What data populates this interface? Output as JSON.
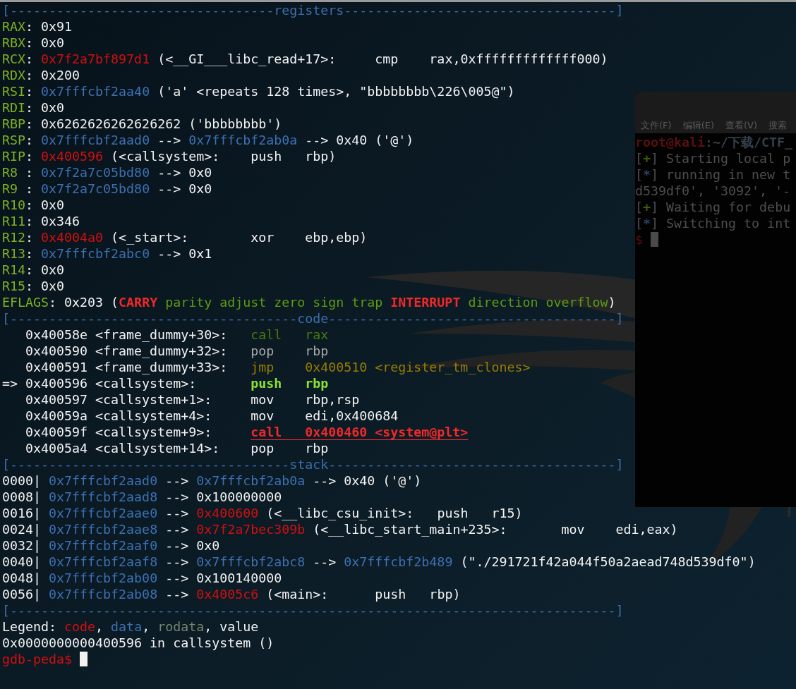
{
  "terminal": {
    "lines": [
      {
        "segments": [
          {
            "text": "[----------------------------------",
            "kind": "header"
          },
          {
            "text": "registers",
            "kind": "header"
          },
          {
            "text": "-----------------------------------]",
            "kind": "header"
          }
        ]
      },
      {
        "segments": [
          {
            "text": "RAX",
            "kind": "reg"
          },
          {
            "text": ": 0x91",
            "kind": "plain"
          }
        ]
      },
      {
        "segments": [
          {
            "text": "RBX",
            "kind": "reg"
          },
          {
            "text": ": 0x0",
            "kind": "plain"
          }
        ]
      },
      {
        "segments": [
          {
            "text": "RCX",
            "kind": "reg"
          },
          {
            "text": ": ",
            "kind": "plain"
          },
          {
            "text": "0x7f2a7bf897d1",
            "kind": "code"
          },
          {
            "text": " (<__GI___libc_read+17>:     cmp    rax,0xfffffffffffff000)",
            "kind": "plain"
          }
        ]
      },
      {
        "segments": [
          {
            "text": "RDX",
            "kind": "reg"
          },
          {
            "text": ": 0x200",
            "kind": "plain"
          }
        ]
      },
      {
        "segments": [
          {
            "text": "RSI",
            "kind": "reg"
          },
          {
            "text": ": ",
            "kind": "plain"
          },
          {
            "text": "0x7fffcbf2aa40",
            "kind": "data"
          },
          {
            "text": " ('a' <repeats 128 times>, \"bbbbbbbb\\226\\005@\")",
            "kind": "plain"
          }
        ]
      },
      {
        "segments": [
          {
            "text": "RDI",
            "kind": "reg"
          },
          {
            "text": ": 0x0",
            "kind": "plain"
          }
        ]
      },
      {
        "segments": [
          {
            "text": "RBP",
            "kind": "reg"
          },
          {
            "text": ": 0x6262626262626262 ('bbbbbbbb')",
            "kind": "plain"
          }
        ]
      },
      {
        "segments": [
          {
            "text": "RSP",
            "kind": "reg"
          },
          {
            "text": ": ",
            "kind": "plain"
          },
          {
            "text": "0x7fffcbf2aad0",
            "kind": "data"
          },
          {
            "text": " --> ",
            "kind": "plain"
          },
          {
            "text": "0x7fffcbf2ab0a",
            "kind": "data"
          },
          {
            "text": " --> 0x40 ('@')",
            "kind": "plain"
          }
        ]
      },
      {
        "segments": [
          {
            "text": "RIP",
            "kind": "reg"
          },
          {
            "text": ": ",
            "kind": "plain"
          },
          {
            "text": "0x400596",
            "kind": "code"
          },
          {
            "text": " (<callsystem>:    push   rbp)",
            "kind": "plain"
          }
        ]
      },
      {
        "segments": [
          {
            "text": "R8 ",
            "kind": "reg"
          },
          {
            "text": ": ",
            "kind": "plain"
          },
          {
            "text": "0x7f2a7c05bd80",
            "kind": "data"
          },
          {
            "text": " --> 0x0",
            "kind": "plain"
          }
        ]
      },
      {
        "segments": [
          {
            "text": "R9 ",
            "kind": "reg"
          },
          {
            "text": ": ",
            "kind": "plain"
          },
          {
            "text": "0x7f2a7c05bd80",
            "kind": "data"
          },
          {
            "text": " --> 0x0",
            "kind": "plain"
          }
        ]
      },
      {
        "segments": [
          {
            "text": "R10",
            "kind": "reg"
          },
          {
            "text": ": 0x0",
            "kind": "plain"
          }
        ]
      },
      {
        "segments": [
          {
            "text": "R11",
            "kind": "reg"
          },
          {
            "text": ": 0x346",
            "kind": "plain"
          }
        ]
      },
      {
        "segments": [
          {
            "text": "R12",
            "kind": "reg"
          },
          {
            "text": ": ",
            "kind": "plain"
          },
          {
            "text": "0x4004a0",
            "kind": "code"
          },
          {
            "text": " (<_start>:        xor    ebp,ebp)",
            "kind": "plain"
          }
        ]
      },
      {
        "segments": [
          {
            "text": "R13",
            "kind": "reg"
          },
          {
            "text": ": ",
            "kind": "plain"
          },
          {
            "text": "0x7fffcbf2abc0",
            "kind": "data"
          },
          {
            "text": " --> 0x1",
            "kind": "plain"
          }
        ]
      },
      {
        "segments": [
          {
            "text": "R14",
            "kind": "reg"
          },
          {
            "text": ": 0x0",
            "kind": "plain"
          }
        ]
      },
      {
        "segments": [
          {
            "text": "R15",
            "kind": "reg"
          },
          {
            "text": ": 0x0",
            "kind": "plain"
          }
        ]
      },
      {
        "segments": [
          {
            "text": "EFLAGS",
            "kind": "reg"
          },
          {
            "text": ": 0x203 (",
            "kind": "plain"
          },
          {
            "text": "CARRY",
            "kind": "flag_set"
          },
          {
            "text": " parity adjust zero sign trap ",
            "kind": "flag_clear"
          },
          {
            "text": "INTERRUPT",
            "kind": "flag_set"
          },
          {
            "text": " direction overflow",
            "kind": "flag_clear"
          },
          {
            "text": ")",
            "kind": "plain"
          }
        ]
      },
      {
        "segments": [
          {
            "text": "[-------------------------------------",
            "kind": "header"
          },
          {
            "text": "code",
            "kind": "header"
          },
          {
            "text": "-------------------------------------]",
            "kind": "header"
          }
        ]
      },
      {
        "segments": [
          {
            "text": "   0x40058e <frame_dummy+30>:   ",
            "kind": "plain"
          },
          {
            "text": "call   rax",
            "kind": "done"
          }
        ]
      },
      {
        "segments": [
          {
            "text": "   0x400590 <frame_dummy+32>:   ",
            "kind": "plain"
          },
          {
            "text": "pop    rbp",
            "kind": "dim"
          }
        ]
      },
      {
        "segments": [
          {
            "text": "   0x400591 <frame_dummy+33>:   ",
            "kind": "plain"
          },
          {
            "text": "jmp    0x400510 <register_tm_clones>",
            "kind": "jump"
          }
        ]
      },
      {
        "segments": [
          {
            "text": "=> 0x400596 <callsystem>:       ",
            "kind": "plain"
          },
          {
            "text": "push   rbp",
            "kind": "current"
          }
        ]
      },
      {
        "segments": [
          {
            "text": "   0x400597 <callsystem+1>:     mov    rbp,rsp",
            "kind": "plain"
          }
        ]
      },
      {
        "segments": [
          {
            "text": "   0x40059a <callsystem+4>:     mov    edi,0x400684",
            "kind": "plain"
          }
        ]
      },
      {
        "segments": [
          {
            "text": "   0x40059f <callsystem+9>:     ",
            "kind": "plain"
          },
          {
            "text": "call   0x400460 <system@plt>",
            "kind": "call"
          }
        ]
      },
      {
        "segments": [
          {
            "text": "   0x4005a4 <callsystem+14>:    pop    rbp",
            "kind": "plain"
          }
        ]
      },
      {
        "segments": [
          {
            "text": "[------------------------------------",
            "kind": "header"
          },
          {
            "text": "stack",
            "kind": "header"
          },
          {
            "text": "-------------------------------------]",
            "kind": "header"
          }
        ]
      },
      {
        "segments": [
          {
            "text": "0000| ",
            "kind": "plain"
          },
          {
            "text": "0x7fffcbf2aad0",
            "kind": "data"
          },
          {
            "text": " --> ",
            "kind": "plain"
          },
          {
            "text": "0x7fffcbf2ab0a",
            "kind": "data"
          },
          {
            "text": " --> 0x40 ('@')",
            "kind": "plain"
          }
        ]
      },
      {
        "segments": [
          {
            "text": "0008| ",
            "kind": "plain"
          },
          {
            "text": "0x7fffcbf2aad8",
            "kind": "data"
          },
          {
            "text": " --> 0x100000000",
            "kind": "plain"
          }
        ]
      },
      {
        "segments": [
          {
            "text": "0016| ",
            "kind": "plain"
          },
          {
            "text": "0x7fffcbf2aae0",
            "kind": "data"
          },
          {
            "text": " --> ",
            "kind": "plain"
          },
          {
            "text": "0x400600",
            "kind": "code"
          },
          {
            "text": " (<__libc_csu_init>:   push   r15)",
            "kind": "plain"
          }
        ]
      },
      {
        "segments": [
          {
            "text": "0024| ",
            "kind": "plain"
          },
          {
            "text": "0x7fffcbf2aae8",
            "kind": "data"
          },
          {
            "text": " --> ",
            "kind": "plain"
          },
          {
            "text": "0x7f2a7bec309b",
            "kind": "code"
          },
          {
            "text": " (<__libc_start_main+235>:       mov    edi,eax)",
            "kind": "plain"
          }
        ]
      },
      {
        "segments": [
          {
            "text": "0032| ",
            "kind": "plain"
          },
          {
            "text": "0x7fffcbf2aaf0",
            "kind": "data"
          },
          {
            "text": " --> 0x0",
            "kind": "plain"
          }
        ]
      },
      {
        "segments": [
          {
            "text": "0040| ",
            "kind": "plain"
          },
          {
            "text": "0x7fffcbf2aaf8",
            "kind": "data"
          },
          {
            "text": " --> ",
            "kind": "plain"
          },
          {
            "text": "0x7fffcbf2abc8",
            "kind": "data"
          },
          {
            "text": " --> ",
            "kind": "plain"
          },
          {
            "text": "0x7fffcbf2b489",
            "kind": "data"
          },
          {
            "text": " (\"./291721f42a044f50a2aead748d539df0\")",
            "kind": "plain"
          }
        ]
      },
      {
        "segments": [
          {
            "text": "0048| ",
            "kind": "plain"
          },
          {
            "text": "0x7fffcbf2ab00",
            "kind": "data"
          },
          {
            "text": " --> 0x100140000",
            "kind": "plain"
          }
        ]
      },
      {
        "segments": [
          {
            "text": "0056| ",
            "kind": "plain"
          },
          {
            "text": "0x7fffcbf2ab08",
            "kind": "data"
          },
          {
            "text": " --> ",
            "kind": "plain"
          },
          {
            "text": "0x4005c6",
            "kind": "code"
          },
          {
            "text": " (<main>:      push   rbp)",
            "kind": "plain"
          }
        ]
      },
      {
        "segments": [
          {
            "text": "[------------------------------------------------------------------------------]",
            "kind": "header"
          }
        ]
      },
      {
        "segments": [
          {
            "text": "Legend: ",
            "kind": "plain"
          },
          {
            "text": "code",
            "kind": "code"
          },
          {
            "text": ", ",
            "kind": "plain"
          },
          {
            "text": "data",
            "kind": "data"
          },
          {
            "text": ", ",
            "kind": "plain"
          },
          {
            "text": "rodata",
            "kind": "rodata"
          },
          {
            "text": ", value",
            "kind": "plain"
          }
        ]
      },
      {
        "segments": [
          {
            "text": "0x0000000000400596 in callsystem ()",
            "kind": "plain"
          }
        ]
      },
      {
        "segments": [
          {
            "text": "gdb-peda$ ",
            "kind": "prompt"
          }
        ]
      }
    ]
  },
  "background_window": {
    "menu": [
      "文件(F)",
      "编辑(E)",
      "查看(V)",
      "搜索"
    ],
    "lines": [
      {
        "segments": [
          {
            "text": "root@kali",
            "kind": "user"
          },
          {
            "text": ":",
            "kind": "plain"
          },
          {
            "text": "~/下载/CTF_",
            "kind": "path"
          }
        ]
      },
      {
        "segments": [
          {
            "text": "[",
            "kind": "plain"
          },
          {
            "text": "+",
            "kind": "plus"
          },
          {
            "text": "] Starting local p",
            "kind": "plain"
          }
        ]
      },
      {
        "segments": [
          {
            "text": "[",
            "kind": "plain"
          },
          {
            "text": "*",
            "kind": "star"
          },
          {
            "text": "] running in new t",
            "kind": "plain"
          }
        ]
      },
      {
        "segments": [
          {
            "text": "d539df0', '3092', '-",
            "kind": "plain"
          }
        ]
      },
      {
        "segments": [
          {
            "text": "[",
            "kind": "plain"
          },
          {
            "text": "+",
            "kind": "plus"
          },
          {
            "text": "] Waiting for debu",
            "kind": "plain"
          }
        ]
      },
      {
        "segments": [
          {
            "text": "[",
            "kind": "plain"
          },
          {
            "text": "*",
            "kind": "star"
          },
          {
            "text": "] Switching to int",
            "kind": "plain"
          }
        ]
      },
      {
        "segments": [
          {
            "text": "$ ",
            "kind": "prompt"
          }
        ]
      }
    ]
  }
}
